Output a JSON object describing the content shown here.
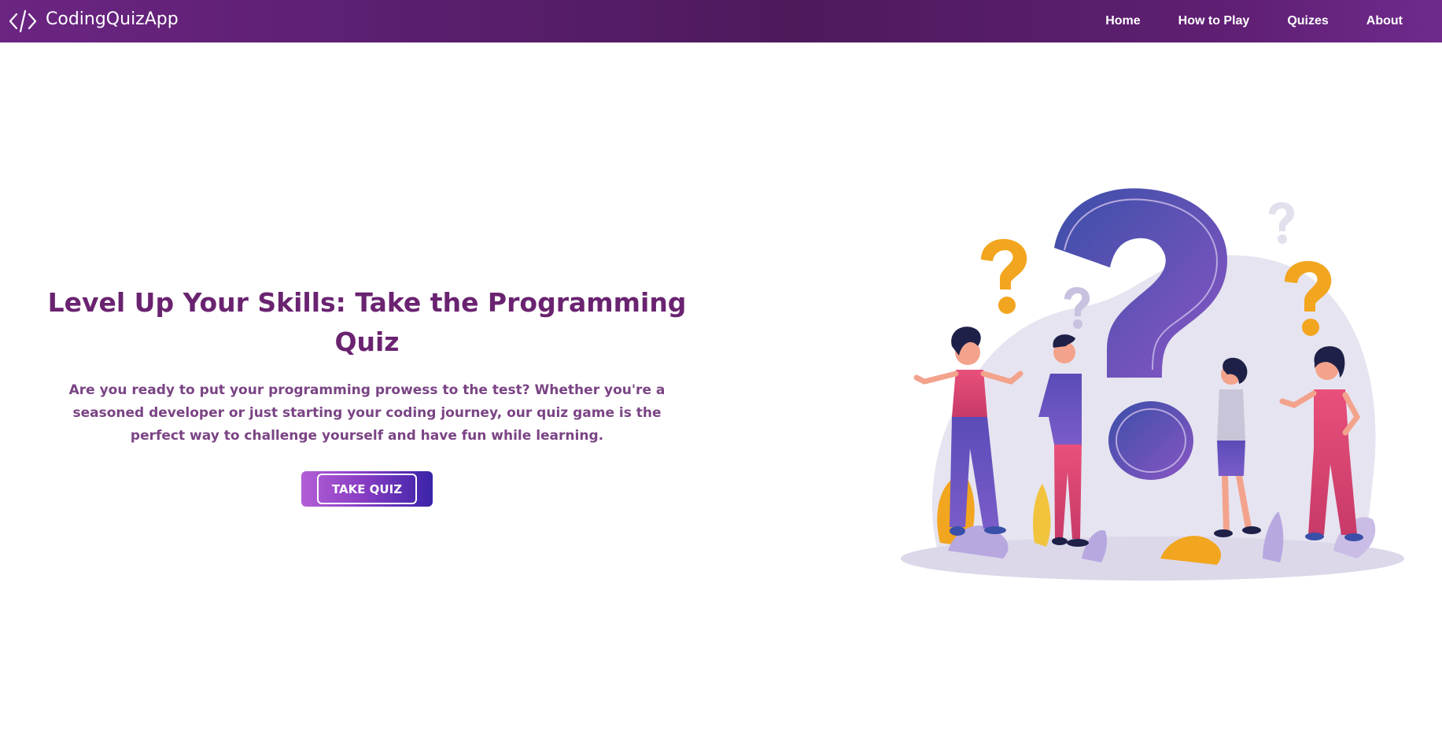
{
  "app": {
    "brand_name": "CodingQuizApp",
    "logo_icon": "code-brackets-icon"
  },
  "nav": {
    "items": [
      {
        "label": "Home"
      },
      {
        "label": "How to Play"
      },
      {
        "label": "Quizes"
      },
      {
        "label": "About"
      }
    ]
  },
  "hero": {
    "title": "Level Up Your Skills: Take the Programming Quiz",
    "description": "Are you ready to put your programming prowess to the test? Whether you're a seasoned developer or just starting your coding journey, our quiz game is the perfect way to challenge yourself and have fun while learning.",
    "cta_label": "TAKE QUIZ"
  },
  "colors": {
    "navbar": "#5a1e6e",
    "title": "#6a2370",
    "description": "#7a4484",
    "cta_start": "#b35fd6",
    "cta_end": "#3a24a8"
  }
}
